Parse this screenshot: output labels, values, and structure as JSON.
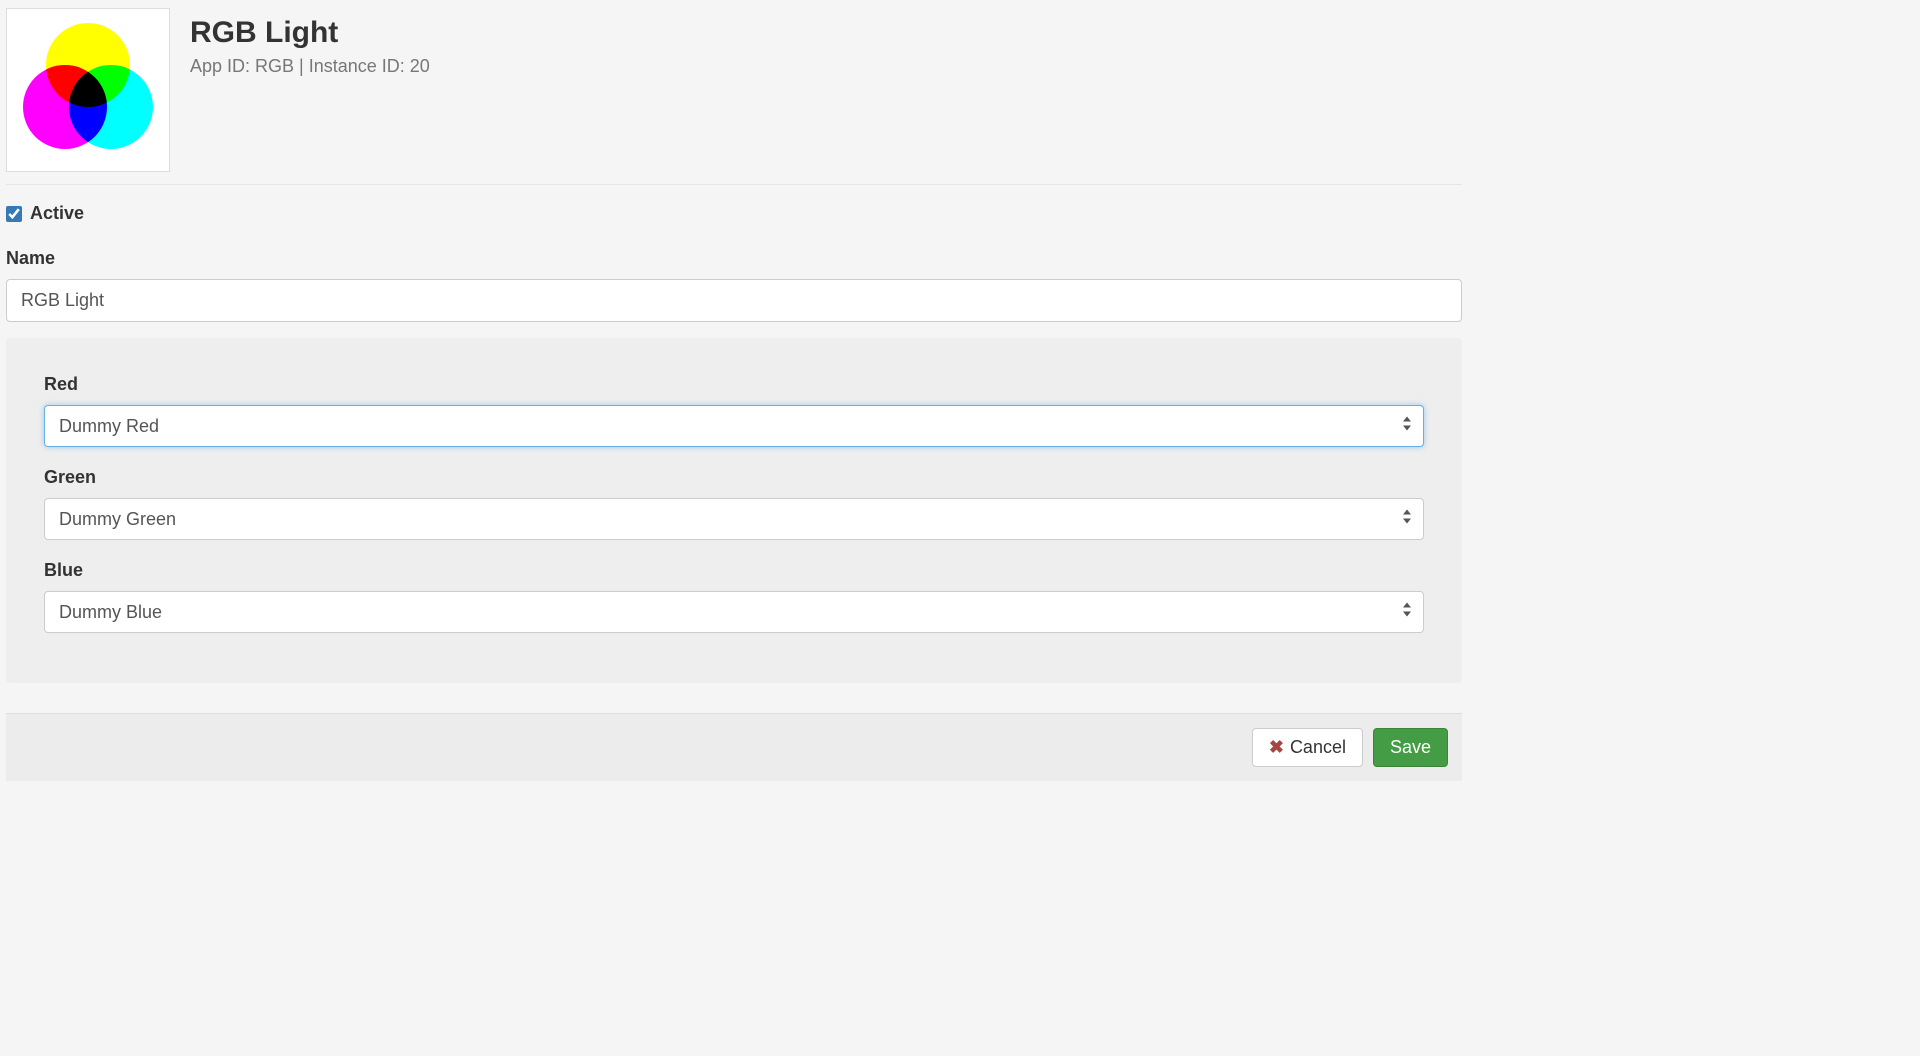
{
  "header": {
    "title": "RGB Light",
    "subid": "App ID: RGB | Instance ID: 20"
  },
  "form": {
    "active_label": "Active",
    "active_checked": true,
    "name_label": "Name",
    "name_value": "RGB Light"
  },
  "panel": {
    "red_label": "Red",
    "red_value": "Dummy Red",
    "green_label": "Green",
    "green_value": "Dummy Green",
    "blue_label": "Blue",
    "blue_value": "Dummy Blue"
  },
  "footer": {
    "cancel_label": "Cancel",
    "save_label": "Save"
  }
}
